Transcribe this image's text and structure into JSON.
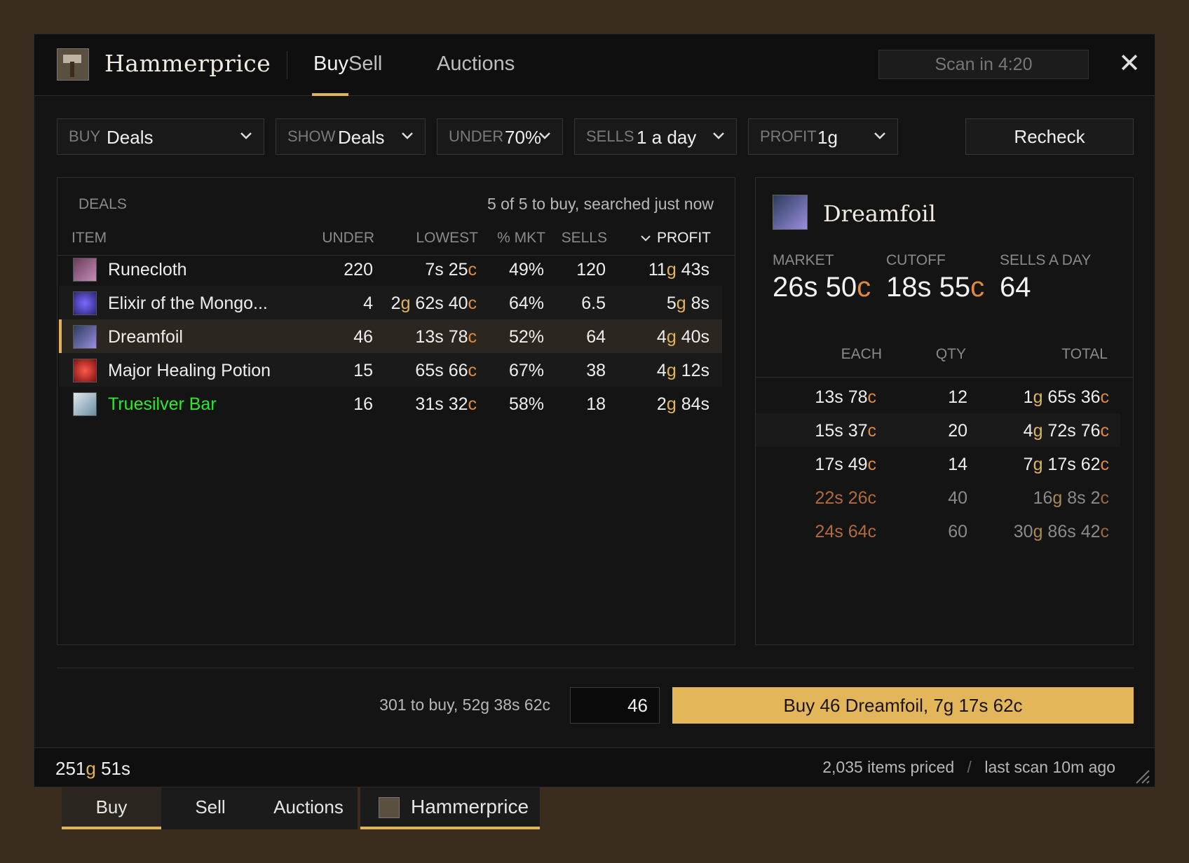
{
  "app": {
    "title": "Hammerprice"
  },
  "tabs": [
    {
      "label": "Buy"
    },
    {
      "label": "Sell"
    },
    {
      "label": "Auctions"
    }
  ],
  "scan": {
    "label": "Scan in 4:20"
  },
  "close": {
    "label": "✕"
  },
  "filters": {
    "buy": {
      "label": "BUY",
      "value": "Deals"
    },
    "show": {
      "label": "SHOW",
      "value": "Deals"
    },
    "under": {
      "label": "UNDER",
      "value": "70%"
    },
    "sells": {
      "label": "SELLS",
      "value": "1 a day"
    },
    "profit": {
      "label": "PROFIT",
      "value": "1g"
    },
    "recheck": "Recheck"
  },
  "deals": {
    "label": "DEALS",
    "status": "5 of 5 to buy, searched just now",
    "columns": {
      "item": "ITEM",
      "under": "UNDER",
      "lowest": "LOWEST",
      "mkt": "% MKT",
      "sells": "SELLS",
      "profit": "PROFIT"
    },
    "sort_icon": "chevron-down-icon",
    "rows": [
      {
        "icon": "runecloth-icon",
        "name": "Runecloth",
        "under": "220",
        "lowest": {
          "g": "",
          "s": "7",
          "c": "25"
        },
        "mkt": "49%",
        "sells": "120",
        "profit": {
          "g": "11",
          "s": "43"
        }
      },
      {
        "icon": "elixir-icon",
        "name": "Elixir of the Mongo...",
        "under": "4",
        "lowest": {
          "g": "2",
          "s": "62",
          "c": "40"
        },
        "mkt": "64%",
        "sells": "6.5",
        "profit": {
          "g": "5",
          "s": "8"
        }
      },
      {
        "icon": "dreamfoil-icon",
        "name": "Dreamfoil",
        "under": "46",
        "lowest": {
          "g": "",
          "s": "13",
          "c": "78"
        },
        "mkt": "52%",
        "sells": "64",
        "profit": {
          "g": "4",
          "s": "40"
        }
      },
      {
        "icon": "healing-potion-icon",
        "name": "Major Healing Potion",
        "under": "15",
        "lowest": {
          "g": "",
          "s": "65",
          "c": "66"
        },
        "mkt": "67%",
        "sells": "38",
        "profit": {
          "g": "4",
          "s": "12"
        }
      },
      {
        "icon": "truesilver-bar-icon",
        "name": "Truesilver Bar",
        "under": "16",
        "lowest": {
          "g": "",
          "s": "31",
          "c": "32"
        },
        "mkt": "58%",
        "sells": "18",
        "profit": {
          "g": "2",
          "s": "84"
        }
      }
    ]
  },
  "detail": {
    "title": "Dreamfoil",
    "icon": "dreamfoil-icon",
    "market_label": "MARKET",
    "market": {
      "s": "26",
      "c": "50"
    },
    "cutoff_label": "CUTOFF",
    "cutoff": {
      "s": "18",
      "c": "55"
    },
    "sells_label": "SELLS A DAY",
    "sells": "64",
    "columns": {
      "each": "EACH",
      "qty": "QTY",
      "total": "TOTAL"
    },
    "orders": [
      {
        "each": {
          "s": "13",
          "c": "78"
        },
        "qty": "12",
        "total": {
          "g": "1",
          "s": "65",
          "c": "36"
        }
      },
      {
        "each": {
          "s": "15",
          "c": "37"
        },
        "qty": "20",
        "total": {
          "g": "4",
          "s": "72",
          "c": "76"
        }
      },
      {
        "each": {
          "s": "17",
          "c": "49"
        },
        "qty": "14",
        "total": {
          "g": "7",
          "s": "17",
          "c": "62"
        }
      },
      {
        "each": {
          "s": "22",
          "c": "26"
        },
        "qty": "40",
        "total": {
          "g": "16",
          "s": "8",
          "c": "2"
        }
      },
      {
        "each": {
          "s": "24",
          "c": "64"
        },
        "qty": "60",
        "total": {
          "g": "30",
          "s": "86",
          "c": "42"
        }
      }
    ]
  },
  "buybar": {
    "summary": "301 to buy, 52g 38s 62c",
    "qty": "46",
    "button": "Buy 46 Dreamfoil, 7g 17s 62c"
  },
  "status": {
    "gold": {
      "g": "251",
      "s": "51"
    },
    "items_priced": "2,035 items priced",
    "separator": "/",
    "last_scan": "last scan 10m ago"
  },
  "taskbar": {
    "buy": "Buy",
    "sell": "Sell",
    "auctions": "Auctions",
    "app": "Hammerprice"
  },
  "colors": {
    "accent": "#e0b45a",
    "gold": "#e0b45a",
    "copper": "#e08a3a",
    "green_item": "#2ee82e"
  }
}
